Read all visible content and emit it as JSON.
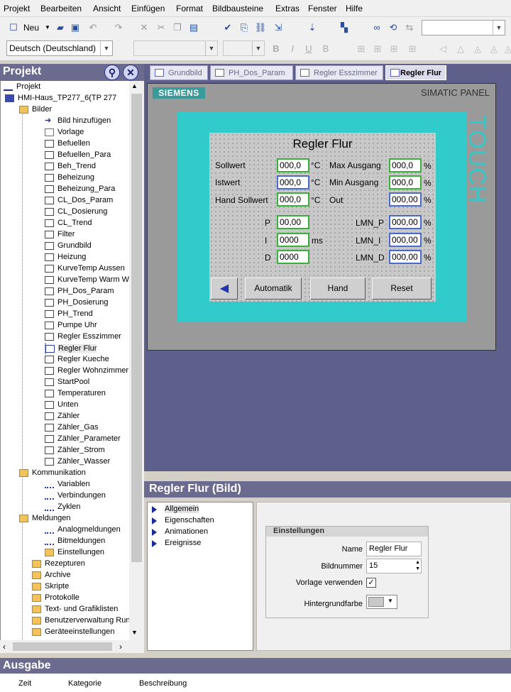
{
  "menu": [
    "Projekt",
    "Bearbeiten",
    "Ansicht",
    "Einfügen",
    "Format",
    "Bildbausteine",
    "Extras",
    "Fenster",
    "Hilfe"
  ],
  "toolbar": {
    "new_label": "Neu",
    "language": "Deutsch (Deutschland)"
  },
  "project_panel": {
    "title": "Projekt",
    "root": "Projekt",
    "device": "HMI-Haus_TP277_6(TP 277",
    "bilder_folder": "Bilder",
    "bilder": [
      "Bild hinzufügen",
      "Vorlage",
      "Befuellen",
      "Befuellen_Para",
      "Beh_Trend",
      "Beheizung",
      "Beheizung_Para",
      "CL_Dos_Param",
      "CL_Dosierung",
      "CL_Trend",
      "Filter",
      "Grundbild",
      "Heizung",
      "KurveTemp Aussen",
      "KurveTemp Warm W",
      "PH_Dos_Param",
      "PH_Dosierung",
      "PH_Trend",
      "Pumpe Uhr",
      "Regler Esszimmer",
      "Regler Flur",
      "Regler Kueche",
      "Regler Wohnzimmer",
      "StartPool",
      "Temperaturen",
      "Unten",
      "Zähler",
      "Zähler_Gas",
      "Zähler_Parameter",
      "Zähler_Strom",
      "Zähler_Wasser"
    ],
    "kommunikation": "Kommunikation",
    "kommunikation_items": [
      "Variablen",
      "Verbindungen",
      "Zyklen"
    ],
    "meldungen": "Meldungen",
    "meldungen_items": [
      "Analogmeldungen",
      "Bitmeldungen",
      "Einstellungen"
    ],
    "other_folders": [
      "Rezepturen",
      "Archive",
      "Skripte",
      "Protokolle",
      "Text- und Grafiklisten",
      "Benutzerverwaltung Runt",
      "Geräteeinstellungen"
    ]
  },
  "tabs": [
    "Grundbild",
    "PH_Dos_Param",
    "Regler Esszimmer",
    "Regler Flur"
  ],
  "panel": {
    "brand": "SIEMENS",
    "model": "SIMATIC PANEL",
    "touch": "TOUCH",
    "screen_title": "Regler Flur",
    "sollwert_label": "Sollwert",
    "sollwert": "000,0",
    "sollwert_unit": "°C",
    "istwert_label": "Istwert",
    "istwert": "000,0",
    "istwert_unit": "°C",
    "hand_label": "Hand Sollwert",
    "hand": "000,0",
    "hand_unit": "°C",
    "max_label": "Max Ausgang",
    "max": "000,0",
    "max_unit": "%",
    "min_label": "Min Ausgang",
    "min": "000,0",
    "min_unit": "%",
    "out_label": "Out",
    "out": "000,00",
    "out_unit": "%",
    "p_label": "P",
    "p": "00,00",
    "i_label": "I",
    "i": "0000",
    "i_unit": "ms",
    "d_label": "D",
    "d": "0000",
    "lmn_p_label": "LMN_P",
    "lmn_p": "000,00",
    "lmn_p_unit": "%",
    "lmn_i_label": "LMN_I",
    "lmn_i": "000,00",
    "lmn_i_unit": "%",
    "lmn_d_label": "LMN_D",
    "lmn_d": "000,00",
    "lmn_d_unit": "%",
    "btn_back": "◀",
    "btn_auto": "Automatik",
    "btn_hand": "Hand",
    "btn_reset": "Reset"
  },
  "properties": {
    "title": "Regler Flur (Bild)",
    "nav": [
      "Allgemein",
      "Eigenschaften",
      "Animationen",
      "Ereignisse"
    ],
    "group": "Einstellungen",
    "name_label": "Name",
    "name_value": "Regler Flur",
    "bildnummer_label": "Bildnummer",
    "bildnummer_value": "15",
    "vorlage_label": "Vorlage verwenden",
    "vorlage_checked": "✓",
    "hintergrund_label": "Hintergrundfarbe"
  },
  "output": {
    "title": "Ausgabe",
    "col_time": "Zeit",
    "col_cat": "Kategorie",
    "col_desc": "Beschreibung"
  }
}
